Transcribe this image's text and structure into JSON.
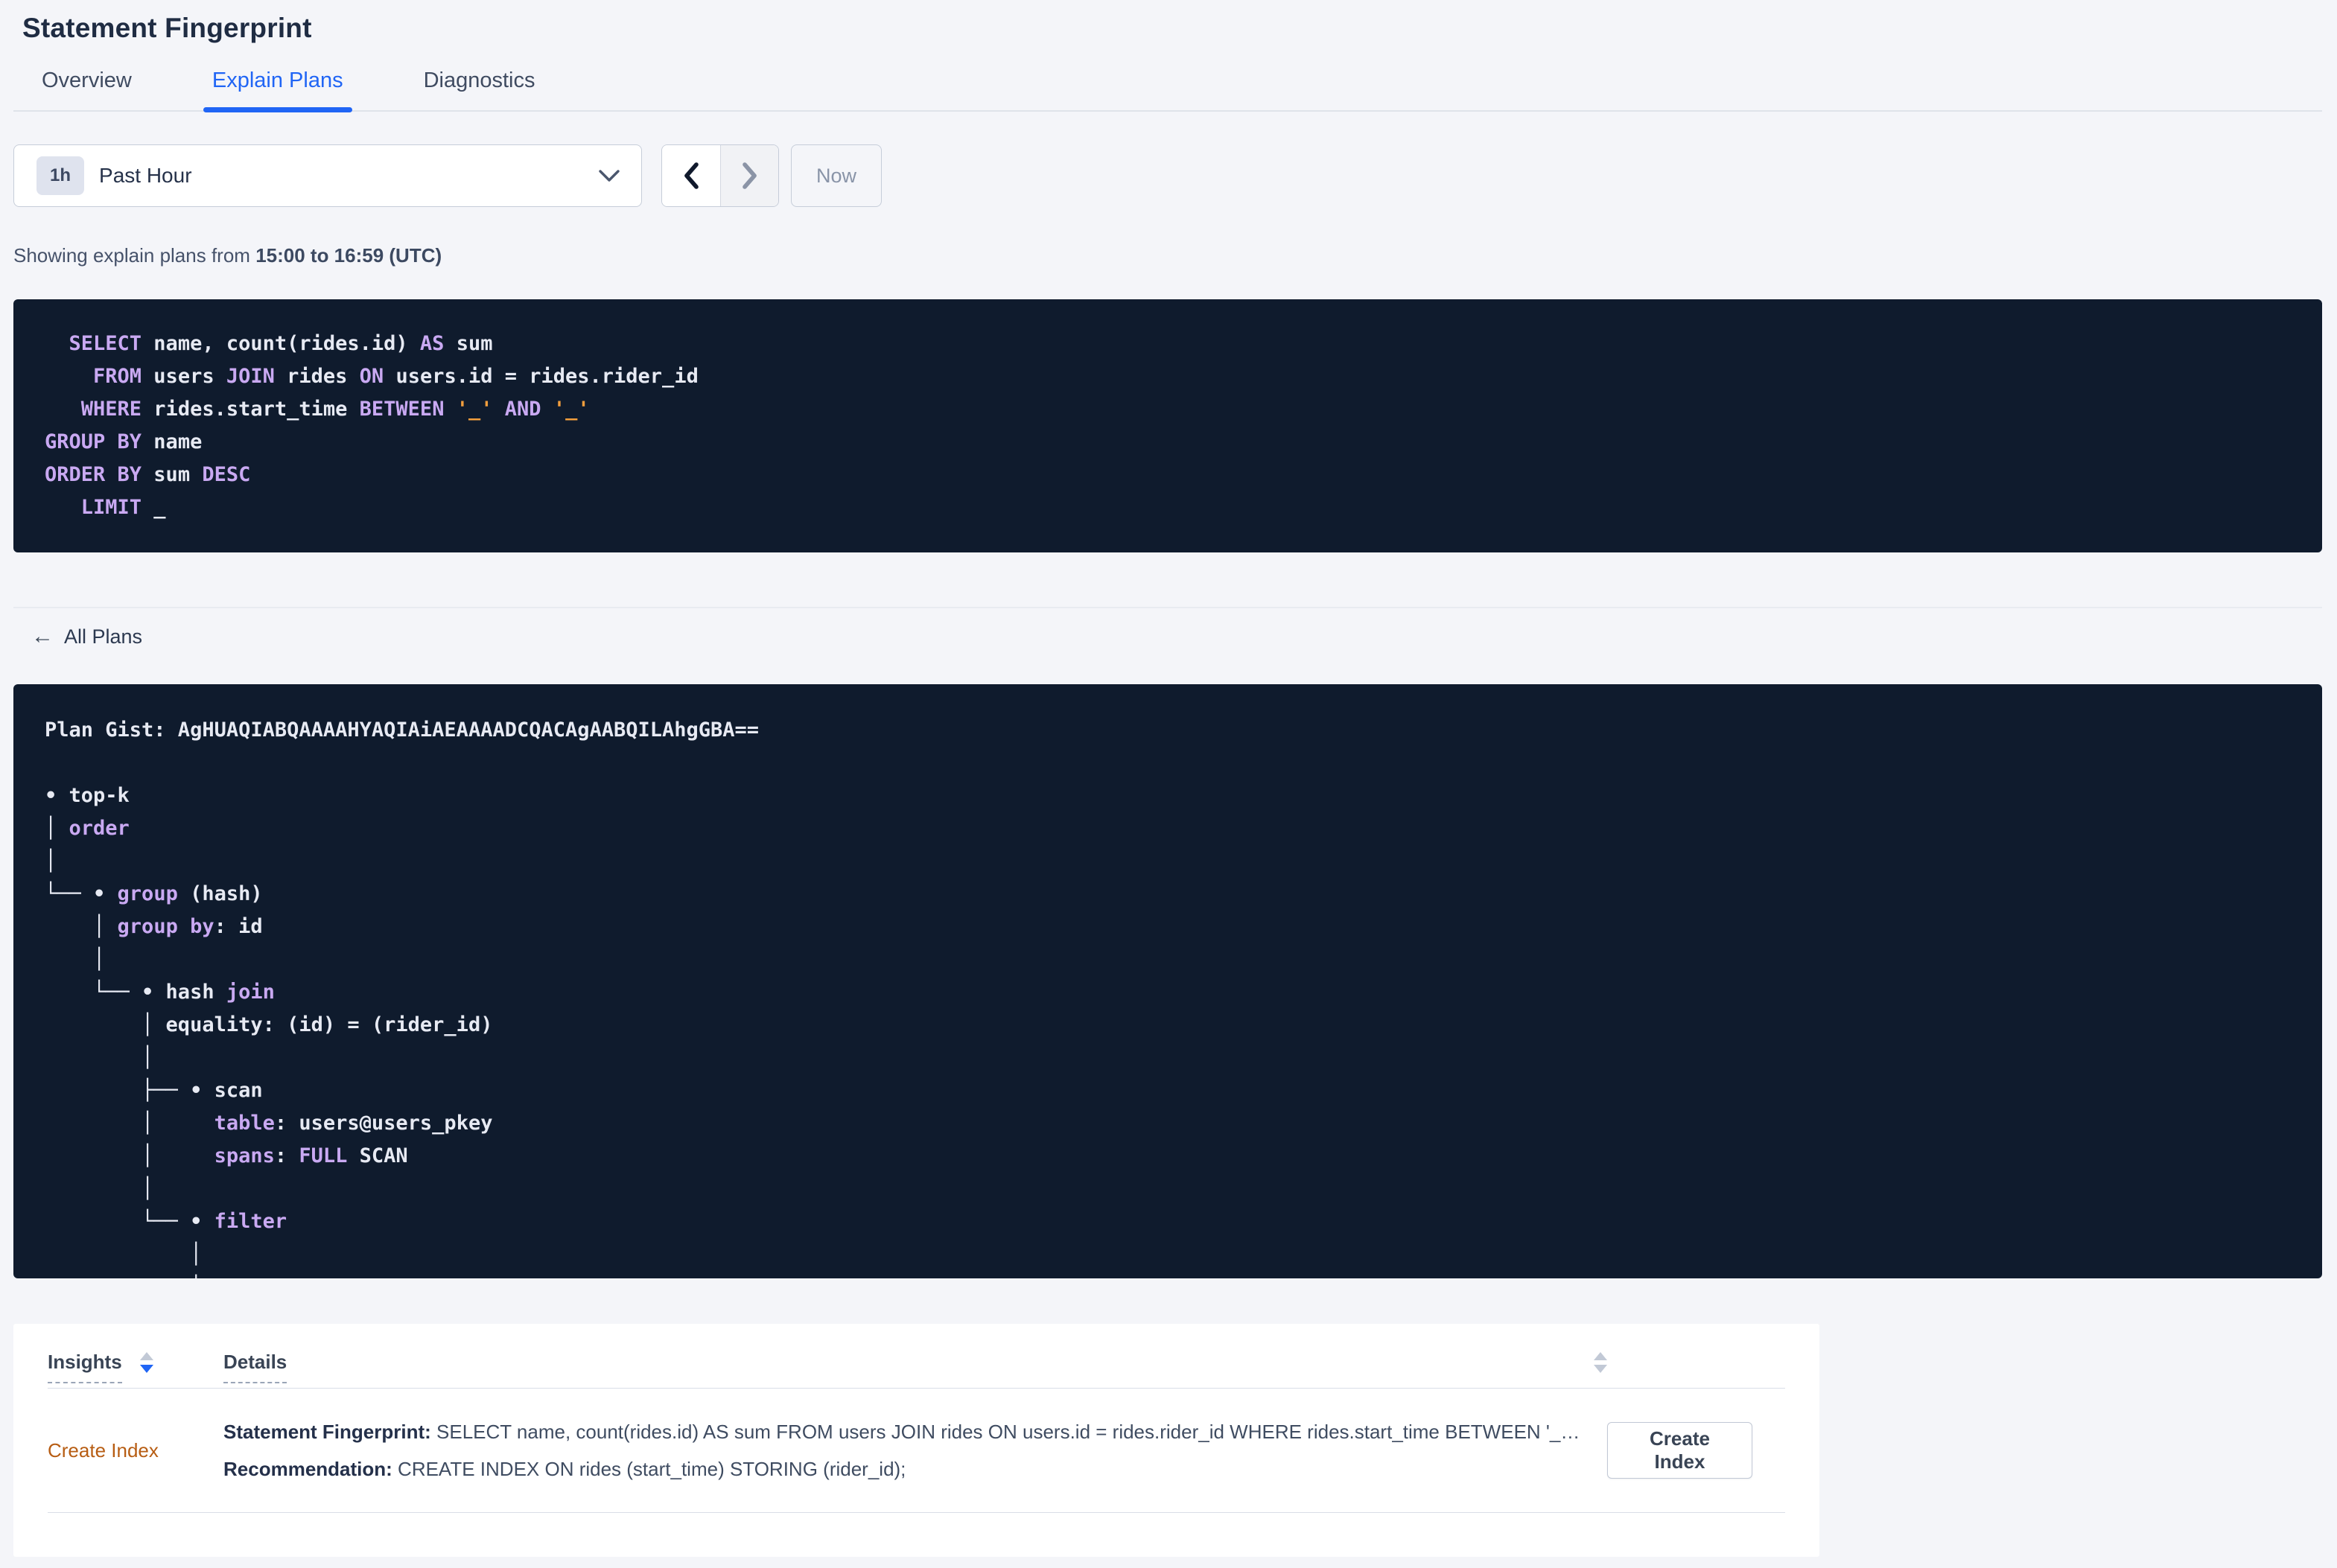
{
  "page": {
    "title": "Statement Fingerprint"
  },
  "tabs": [
    {
      "label": "Overview",
      "active": false
    },
    {
      "label": "Explain Plans",
      "active": true
    },
    {
      "label": "Diagnostics",
      "active": false
    }
  ],
  "toolbar": {
    "range_badge": "1h",
    "range_label": "Past Hour",
    "now_label": "Now",
    "prev_enabled": true,
    "next_enabled": false
  },
  "subtitle": {
    "prefix": "Showing explain plans from ",
    "bold": "15:00 to 16:59 (UTC)"
  },
  "sql_block": {
    "lines": [
      [
        [
          "kw",
          "  SELECT"
        ],
        [
          "pl",
          " name, count(rides.id) "
        ],
        [
          "kw",
          "AS"
        ],
        [
          "pl",
          " sum"
        ]
      ],
      [
        [
          "kw",
          "    FROM"
        ],
        [
          "pl",
          " users "
        ],
        [
          "kw",
          "JOIN"
        ],
        [
          "pl",
          " rides "
        ],
        [
          "kw",
          "ON"
        ],
        [
          "pl",
          " users.id = rides.rider_id"
        ]
      ],
      [
        [
          "kw",
          "   WHERE"
        ],
        [
          "pl",
          " rides.start_time "
        ],
        [
          "kw",
          "BETWEEN"
        ],
        [
          "pl",
          " "
        ],
        [
          "str",
          "'_'"
        ],
        [
          "pl",
          " "
        ],
        [
          "kw",
          "AND"
        ],
        [
          "pl",
          " "
        ],
        [
          "str",
          "'_'"
        ]
      ],
      [
        [
          "kw",
          "GROUP BY"
        ],
        [
          "pl",
          " name"
        ]
      ],
      [
        [
          "kw",
          "ORDER BY"
        ],
        [
          "pl",
          " sum "
        ],
        [
          "kw",
          "DESC"
        ]
      ],
      [
        [
          "kw",
          "   LIMIT"
        ],
        [
          "pl",
          " _"
        ]
      ]
    ]
  },
  "plans_nav": {
    "back_label": "All Plans",
    "back_icon": "arrow-left"
  },
  "plan_block": {
    "gist_label": "Plan Gist: AgHUAQIABQAAAAHYAQIAiAEAAAADCQACAgAABQILAhgGBA==",
    "lines": [
      [
        [
          "pl",
          "Plan Gist: AgHUAQIABQAAAAHYAQIAiAEAAAADCQACAgAABQILAhgGBA=="
        ]
      ],
      [],
      [
        [
          "pl",
          "• top-k"
        ]
      ],
      [
        [
          "pl",
          "│ "
        ],
        [
          "kw",
          "order"
        ]
      ],
      [
        [
          "pl",
          "│"
        ]
      ],
      [
        [
          "pl",
          "└── • "
        ],
        [
          "kw",
          "group"
        ],
        [
          "pl",
          " (hash)"
        ]
      ],
      [
        [
          "pl",
          "    │ "
        ],
        [
          "kw",
          "group by"
        ],
        [
          "pl",
          ": id"
        ]
      ],
      [
        [
          "pl",
          "    │"
        ]
      ],
      [
        [
          "pl",
          "    └── • hash "
        ],
        [
          "kw",
          "join"
        ]
      ],
      [
        [
          "pl",
          "        │ equality: (id) = (rider_id)"
        ]
      ],
      [
        [
          "pl",
          "        │"
        ]
      ],
      [
        [
          "pl",
          "        ├── • scan"
        ]
      ],
      [
        [
          "pl",
          "        │     "
        ],
        [
          "kw",
          "table"
        ],
        [
          "pl",
          ": users@users_pkey"
        ]
      ],
      [
        [
          "pl",
          "        │     "
        ],
        [
          "kw",
          "spans"
        ],
        [
          "pl",
          ": "
        ],
        [
          "kw",
          "FULL"
        ],
        [
          "pl",
          " SCAN"
        ]
      ],
      [
        [
          "pl",
          "        │"
        ]
      ],
      [
        [
          "pl",
          "        └── • "
        ],
        [
          "kw",
          "filter"
        ]
      ],
      [
        [
          "pl",
          "            │"
        ]
      ],
      [
        [
          "pl",
          "            │"
        ]
      ]
    ]
  },
  "insights_table": {
    "columns": [
      {
        "label": "Insights",
        "sorted": "desc"
      },
      {
        "label": "Details",
        "sorted": "none"
      }
    ],
    "rows": [
      {
        "insight": "Create Index",
        "details": [
          {
            "label": "Statement Fingerprint:",
            "text": " SELECT name, count(rides.id) AS sum FROM users JOIN rides ON users.id = rides.rider_id WHERE rides.start_time BETWEEN '_…"
          },
          {
            "label": "Recommendation:",
            "text": " CREATE INDEX ON rides (start_time) STORING (rider_id);"
          }
        ],
        "action_label": "Create Index"
      }
    ]
  },
  "icons": {
    "dropdown": "chevron-down",
    "prev": "chevron-left",
    "next": "chevron-right",
    "back": "arrow-left",
    "sort": "sort-arrows"
  },
  "colors": {
    "accent_blue": "#2065f5",
    "code_background": "#0f1b2d",
    "code_keyword_purple": "#c9a9f2",
    "code_text_white": "#e7eaf3",
    "code_string_orange": "#f29e3d",
    "insight_link_orange": "#b75d13",
    "page_background": "#f4f5f9"
  }
}
